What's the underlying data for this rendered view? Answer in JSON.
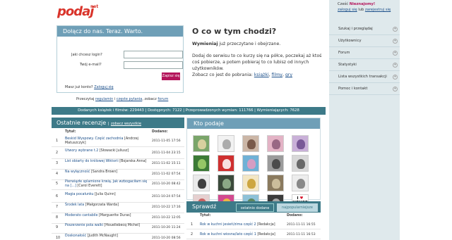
{
  "logo": {
    "text": "podaj",
    "sup": "net"
  },
  "join": {
    "title": "Dołącz do nas. Teraz. Warto.",
    "login_label": "Jaki chcesz login?",
    "email_label": "Twój e-mail?",
    "login_value": "",
    "email_value": "",
    "submit_label": "Zapisz się",
    "has_account": "Masz już konto?",
    "login_link": "Zaloguj się"
  },
  "rules": {
    "prefix": "Przeczytaj",
    "regulamin": "regulamin",
    "sep1": "i",
    "faq": "częste pytania",
    "sep2": ", zobacz",
    "forum": "forum"
  },
  "about": {
    "title": "O co w tym chodzi?",
    "p1_bold": "Wymieniaj",
    "p1_rest": " już przeczytane i obejrzane.",
    "p2": "Dodaj do serwisu to co kurzy się na półce, poczekaj aż ktoś coś pobierze, a potem pobieraj to co lubisz od innych użytkowników.",
    "p3": "Zobacz co jest do pobrania:",
    "links": [
      "książki",
      "filmy",
      "gry"
    ]
  },
  "stats": "Dodanych książek i filmów: 229443 | Dostępnych: 7122 | Przeprowadzonych wymian: 111766 | Wymieniających: 7628",
  "reviews": {
    "title": "Ostatnie recenzje",
    "see_all": "zobacz wszystkie",
    "col_title": "Tytuł:",
    "col_date": "Dodano:",
    "rows": [
      {
        "n": "1",
        "title": "Beskid Wyspowy. Część zachodnia",
        "author": "[Andrzej Matuszczyk]",
        "date": "2011-11-05 17:56"
      },
      {
        "n": "2",
        "title": "Utwory wybrane t.2",
        "author": "[Słowacki Juliusz]",
        "date": "2011-11-04 23:15"
      },
      {
        "n": "3",
        "title": "List obiarty do królowej Wiktorii",
        "author": "[Bojarska Anna]",
        "date": "2011-11-02 15:11"
      },
      {
        "n": "4",
        "title": "Na wyłączność",
        "author": "[Sandra Brown]",
        "date": "2011-11-02 07:54"
      },
      {
        "n": "5",
        "title": "Pierwiązłe splamione krwią. Jak wzbogaciłam się na [...]",
        "author": "[Carol Everett]",
        "date": "2011-10-20 08:42"
      },
      {
        "n": "6",
        "title": "Magia pocałunku",
        "author": "[Julia Quinn]",
        "date": "2011-10-24 07:54"
      },
      {
        "n": "7",
        "title": "Środek lata",
        "author": "[Małgorzata Warda]",
        "date": "2011-10-22 17:16"
      },
      {
        "n": "8",
        "title": "Moderato cantabile",
        "author": "[Marguerite Duras]",
        "date": "2011-10-22 12:05"
      },
      {
        "n": "9",
        "title": "Poszerzenie pola walki",
        "author": "[Houellebecq Michel]",
        "date": "2011-10-20 11:24"
      },
      {
        "n": "10",
        "title": "Doskonałość",
        "author": "[Judith McNaught]",
        "date": "2011-10-20 08:56"
      }
    ]
  },
  "kto": {
    "title": "Kto podaje"
  },
  "avatars": [
    {
      "name": "avatar-palm",
      "bg": "#7aa56a",
      "fg": "#e9d7a8"
    },
    {
      "name": "avatar-drawing",
      "bg": "#f2f2f2",
      "fg": "#a0a0a0"
    },
    {
      "name": "avatar-girl",
      "bg": "#cbb6a6",
      "fg": "#6b4a3a"
    },
    {
      "name": "avatar-pink",
      "bg": "#e3b3c5",
      "fg": "#8c5a78"
    },
    {
      "name": "avatar-purple",
      "bg": "#c9b0d8",
      "fg": "#6b4a8c"
    },
    {
      "name": "avatar-green",
      "bg": "#3c7a36",
      "fg": "#a4d36e"
    },
    {
      "name": "avatar-flag",
      "bg": "#cf3030",
      "fg": "#ffffff"
    },
    {
      "name": "avatar-doll",
      "bg": "#6fb1d6",
      "fg": "#e89ac0"
    },
    {
      "name": "avatar-face",
      "bg": "#9b9b9b",
      "fg": "#3d3d3d"
    },
    {
      "name": "avatar-sketch",
      "bg": "#d8d8d8",
      "fg": "#555555"
    },
    {
      "name": "avatar-eye",
      "bg": "#eaeaea",
      "fg": "#222222"
    },
    {
      "name": "avatar-dark",
      "bg": "#3b4a3b",
      "fg": "#9ab894"
    },
    {
      "name": "avatar-flower",
      "bg": "#f3e6c4",
      "fg": "#c69a2a"
    },
    {
      "name": "avatar-sepia",
      "bg": "#8a7a5e",
      "fg": "#d6c9a6"
    },
    {
      "name": "avatar-cat",
      "bg": "#ededed",
      "fg": "#777777"
    },
    {
      "name": "avatar-candy",
      "bg": "#e6d0d0",
      "fg": "#c44f4f"
    },
    {
      "name": "avatar-rainbow",
      "bg": "#d24a8f",
      "fg": "#f0c93a"
    },
    {
      "name": "avatar-mountain",
      "bg": "#8ec1d8",
      "fg": "#587c4a"
    },
    {
      "name": "avatar-wolf",
      "bg": "#3b3b3b",
      "fg": "#bbbbbb"
    },
    {
      "name": "avatar-house-music",
      "bg": "#ffffff",
      "fg": "#d6162c"
    }
  ],
  "house_music": {
    "line1": "I",
    "line2": "HOUSE",
    "line3": "MUSIC"
  },
  "sprawdz": {
    "title": "Sprawdź",
    "tab_latest": "ostatnio dodane",
    "tab_popular": "najpopularniejsze",
    "col_title": "Tytuł:",
    "col_date": "Dodano:",
    "rows": [
      {
        "n": "1",
        "title": "Rok w kuchni jesień/zima część 2",
        "author": "[Redakcja]",
        "date": "2011-11-11 16:55"
      },
      {
        "n": "2",
        "title": "Rok w kuchni wiosna/lato część 1",
        "author": "[Redakcja]",
        "date": "2011-11-11 16:53"
      }
    ]
  },
  "sidebar": {
    "greet_prefix": "Cześć",
    "greet_name": "Nieznajomy!",
    "login": "zaloguj się",
    "or": "lub",
    "register": "zarejestruj się",
    "items": [
      {
        "label": "Szukaj i przeglądaj"
      },
      {
        "label": "Użytkownicy"
      },
      {
        "label": "Forum"
      },
      {
        "label": "Statystyki"
      },
      {
        "label": "Lista wszystkich transakcji"
      },
      {
        "label": "Pomoc i kontakt"
      }
    ]
  },
  "colors": {
    "accent": "#3d7a88",
    "header_light": "#6f9fb7",
    "brand": "#d9342b",
    "button": "#b4155b",
    "sidebar": "#dfe9ec"
  }
}
